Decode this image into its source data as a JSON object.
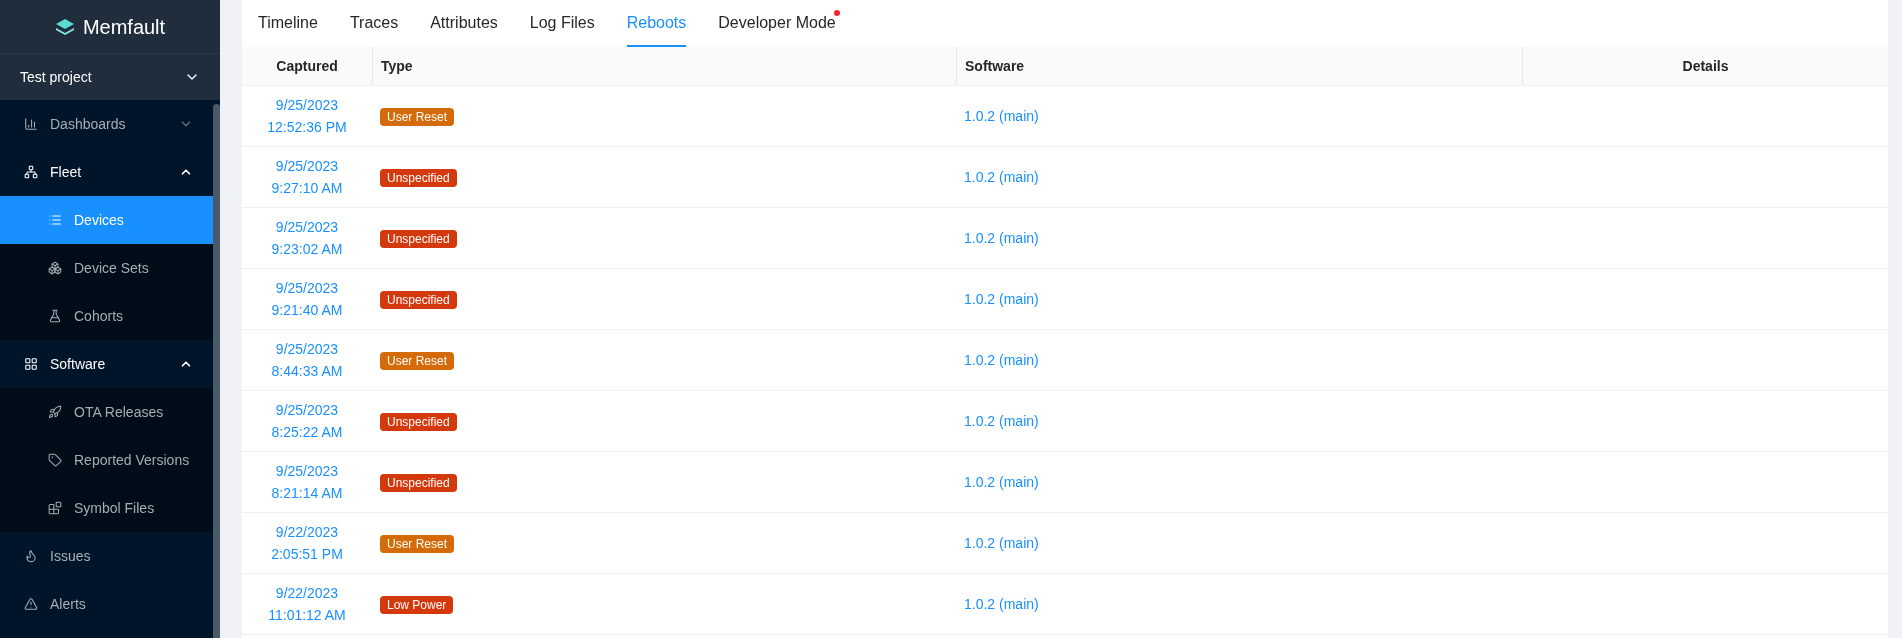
{
  "sidebar": {
    "logo": "Memfault",
    "project": {
      "label": "Test project"
    },
    "items": [
      {
        "label": "Dashboards",
        "expanded": false,
        "selected": false
      },
      {
        "label": "Fleet",
        "expanded": true,
        "selected": false,
        "children": [
          {
            "label": "Devices",
            "selected": true
          },
          {
            "label": "Device Sets",
            "selected": false
          },
          {
            "label": "Cohorts",
            "selected": false
          }
        ]
      },
      {
        "label": "Software",
        "expanded": true,
        "selected": false,
        "children": [
          {
            "label": "OTA Releases",
            "selected": false
          },
          {
            "label": "Reported Versions",
            "selected": false
          },
          {
            "label": "Symbol Files",
            "selected": false
          }
        ]
      },
      {
        "label": "Issues",
        "selected": false
      },
      {
        "label": "Alerts",
        "selected": false
      }
    ]
  },
  "tabs": [
    {
      "label": "Timeline",
      "selected": false,
      "dot": false
    },
    {
      "label": "Traces",
      "selected": false,
      "dot": false
    },
    {
      "label": "Attributes",
      "selected": false,
      "dot": false
    },
    {
      "label": "Log Files",
      "selected": false,
      "dot": false
    },
    {
      "label": "Reboots",
      "selected": true,
      "dot": false
    },
    {
      "label": "Developer Mode",
      "selected": false,
      "dot": true
    }
  ],
  "table": {
    "columns": [
      "Captured",
      "Type",
      "Software",
      "Details"
    ],
    "rows": [
      {
        "date": "9/25/2023",
        "time": "12:52:36 PM",
        "type": "User Reset",
        "color": "#d46b08",
        "software": "1.0.2 (main)"
      },
      {
        "date": "9/25/2023",
        "time": "9:27:10 AM",
        "type": "Unspecified",
        "color": "#d4380d",
        "software": "1.0.2 (main)"
      },
      {
        "date": "9/25/2023",
        "time": "9:23:02 AM",
        "type": "Unspecified",
        "color": "#d4380d",
        "software": "1.0.2 (main)"
      },
      {
        "date": "9/25/2023",
        "time": "9:21:40 AM",
        "type": "Unspecified",
        "color": "#d4380d",
        "software": "1.0.2 (main)"
      },
      {
        "date": "9/25/2023",
        "time": "8:44:33 AM",
        "type": "User Reset",
        "color": "#d46b08",
        "software": "1.0.2 (main)"
      },
      {
        "date": "9/25/2023",
        "time": "8:25:22 AM",
        "type": "Unspecified",
        "color": "#d4380d",
        "software": "1.0.2 (main)"
      },
      {
        "date": "9/25/2023",
        "time": "8:21:14 AM",
        "type": "Unspecified",
        "color": "#d4380d",
        "software": "1.0.2 (main)"
      },
      {
        "date": "9/22/2023",
        "time": "2:05:51 PM",
        "type": "User Reset",
        "color": "#d46b08",
        "software": "1.0.2 (main)"
      },
      {
        "date": "9/22/2023",
        "time": "11:01:12 AM",
        "type": "Low Power",
        "color": "#d4380d",
        "software": "1.0.2 (main)"
      }
    ]
  }
}
